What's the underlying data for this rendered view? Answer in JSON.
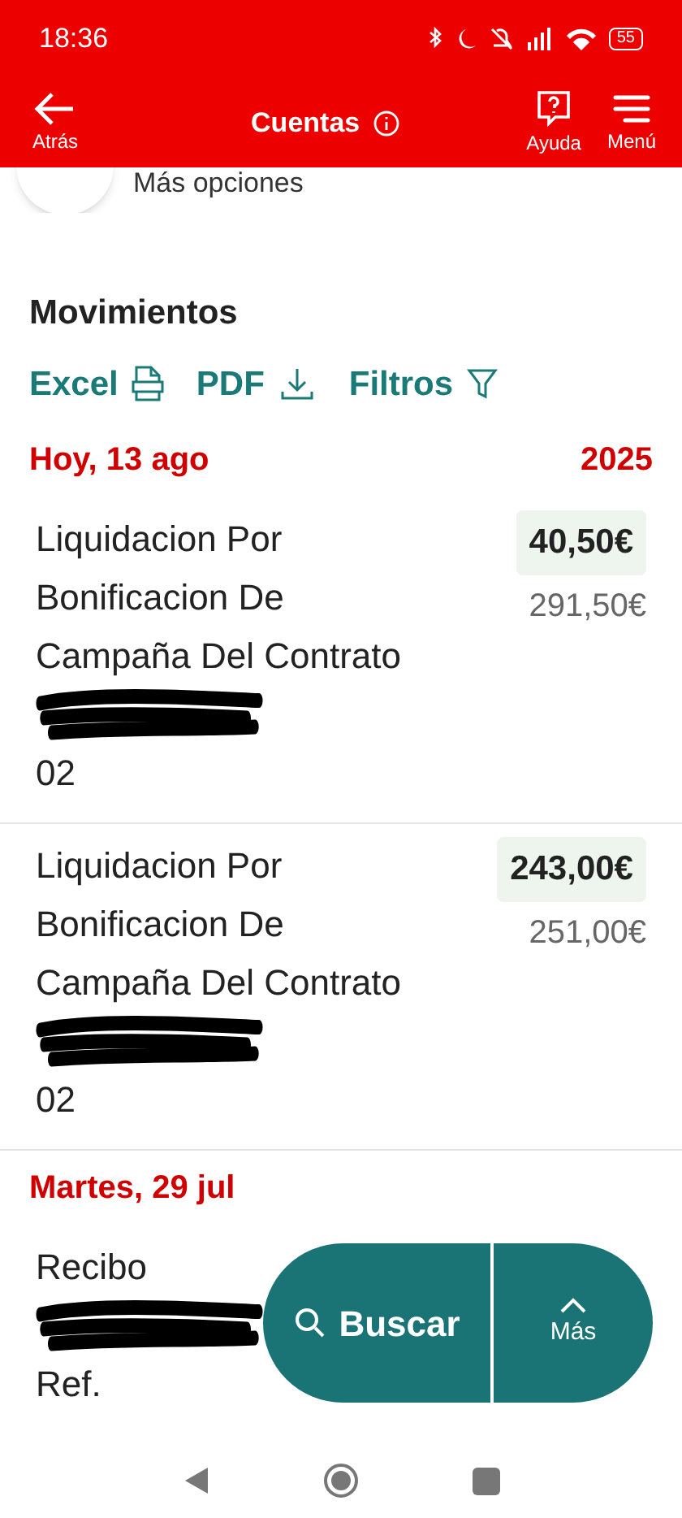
{
  "status_bar": {
    "time": "18:36",
    "battery": "55"
  },
  "header": {
    "back": "Atrás",
    "title": "Cuentas",
    "help": "Ayuda",
    "menu": "Menú"
  },
  "more_options": {
    "label": "Más opciones"
  },
  "section": {
    "title": "Movimientos",
    "actions": [
      {
        "label": "Excel",
        "kind": "xls"
      },
      {
        "label": "PDF",
        "kind": "download"
      },
      {
        "label": "Filtros",
        "kind": "filter"
      }
    ]
  },
  "groups": [
    {
      "date": "Hoy, 13 ago",
      "year": "2025",
      "items": [
        {
          "description": "Liquidacion Por Bonificacion De Campaña Del Contrato",
          "tail": "02",
          "amount": "40,50€",
          "balance": "291,50€",
          "redacted": true
        },
        {
          "description": "Liquidacion Por Bonificacion De Campaña Del Contrato",
          "tail": "02",
          "amount": "243,00€",
          "balance": "251,00€",
          "redacted": true
        }
      ]
    },
    {
      "date": "Martes, 29 jul",
      "items": [
        {
          "description": "Recibo",
          "tail": "Ref.",
          "redacted": true
        }
      ]
    }
  ],
  "fab": {
    "search": "Buscar",
    "more": "Más"
  }
}
